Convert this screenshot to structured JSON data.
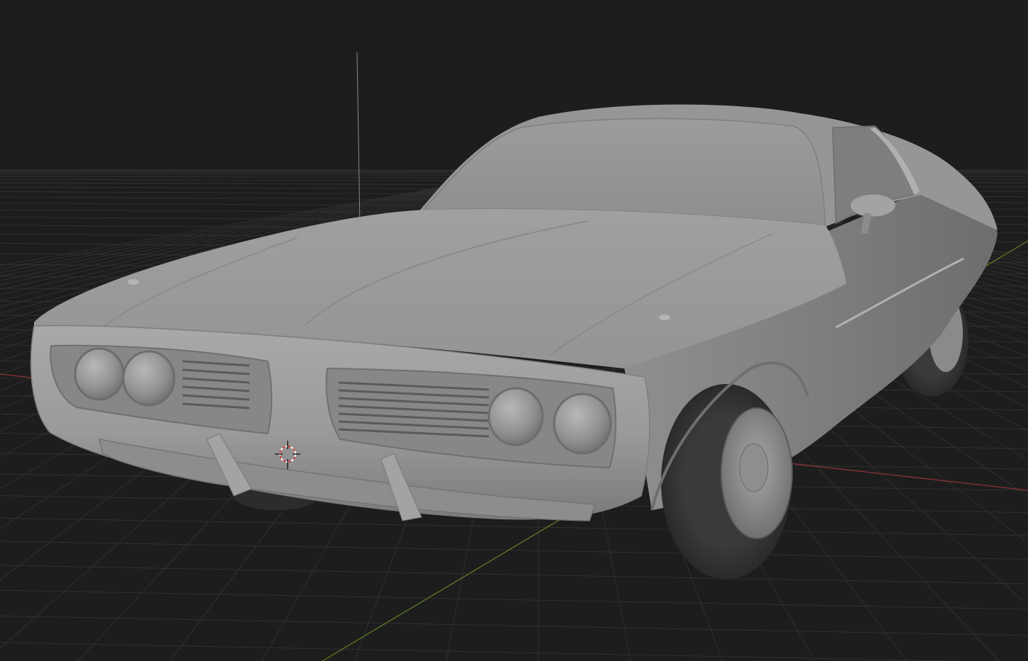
{
  "app": {
    "name": "3D viewport",
    "shading_mode": "solid",
    "background_color": "#1d1d1d"
  },
  "viewport": {
    "grid": {
      "visible": true,
      "line_color": "#303030",
      "x_axis_color": "#a43943",
      "y_axis_color": "#6b8e23"
    },
    "model": {
      "name": "car-model",
      "body_color": "#9a9a9a"
    },
    "cursor_3d": {
      "visible": true,
      "icon": "3d-cursor-icon",
      "ring_color_a": "#d63c3c",
      "ring_color_b": "#ffffff"
    },
    "antenna": {
      "visible": true
    }
  }
}
